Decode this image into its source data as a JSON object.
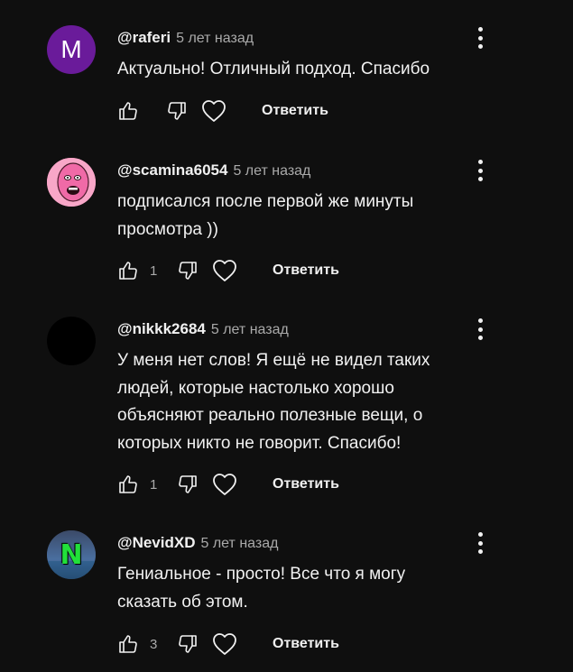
{
  "comments": [
    {
      "author": "@raferi",
      "time": "5 лет назад",
      "text": "Актуально! Отличный подход. Спасибо",
      "likes": "",
      "reply_label": "Ответить",
      "avatar": {
        "type": "letter",
        "letter": "M",
        "color": "#6a1b9a"
      },
      "icons": {
        "like": "thumb-up-icon",
        "dislike": "thumb-down-icon",
        "heart": "heart-icon",
        "menu": "more-vert-icon"
      }
    },
    {
      "author": "@scamina6054",
      "time": "5 лет назад",
      "text": "подписался после первой же минуты просмотра ))",
      "likes": "1",
      "reply_label": "Ответить",
      "avatar": {
        "type": "image",
        "description_icon": "pink-face-avatar",
        "color": "#f47ab0"
      },
      "icons": {
        "like": "thumb-up-icon",
        "dislike": "thumb-down-icon",
        "heart": "heart-icon",
        "menu": "more-vert-icon"
      }
    },
    {
      "author": "@nikkk2684",
      "time": "5 лет назад",
      "text": "У меня нет слов! Я ещё не видел таких людей, которые настолько хорошо объясняют реально полезные вещи, о которых никто не говорит. Спасибо!",
      "likes": "1",
      "reply_label": "Ответить",
      "avatar": {
        "type": "solid",
        "color": "#000000"
      },
      "icons": {
        "like": "thumb-up-icon",
        "dislike": "thumb-down-icon",
        "heart": "heart-icon",
        "menu": "more-vert-icon"
      }
    },
    {
      "author": "@NevidXD",
      "time": "5 лет назад",
      "text": "Гениальное - просто! Все что я могу сказать об этом.",
      "likes": "3",
      "reply_label": "Ответить",
      "avatar": {
        "type": "image",
        "letter": "N",
        "color": "#2f3a4f",
        "letter_color": "#22e03a"
      },
      "icons": {
        "like": "thumb-up-icon",
        "dislike": "thumb-down-icon",
        "heart": "heart-icon",
        "menu": "more-vert-icon"
      }
    }
  ],
  "colors": {
    "background": "#0f0f0f",
    "text_primary": "#f1f1f1",
    "text_secondary": "#aaaaaa"
  }
}
